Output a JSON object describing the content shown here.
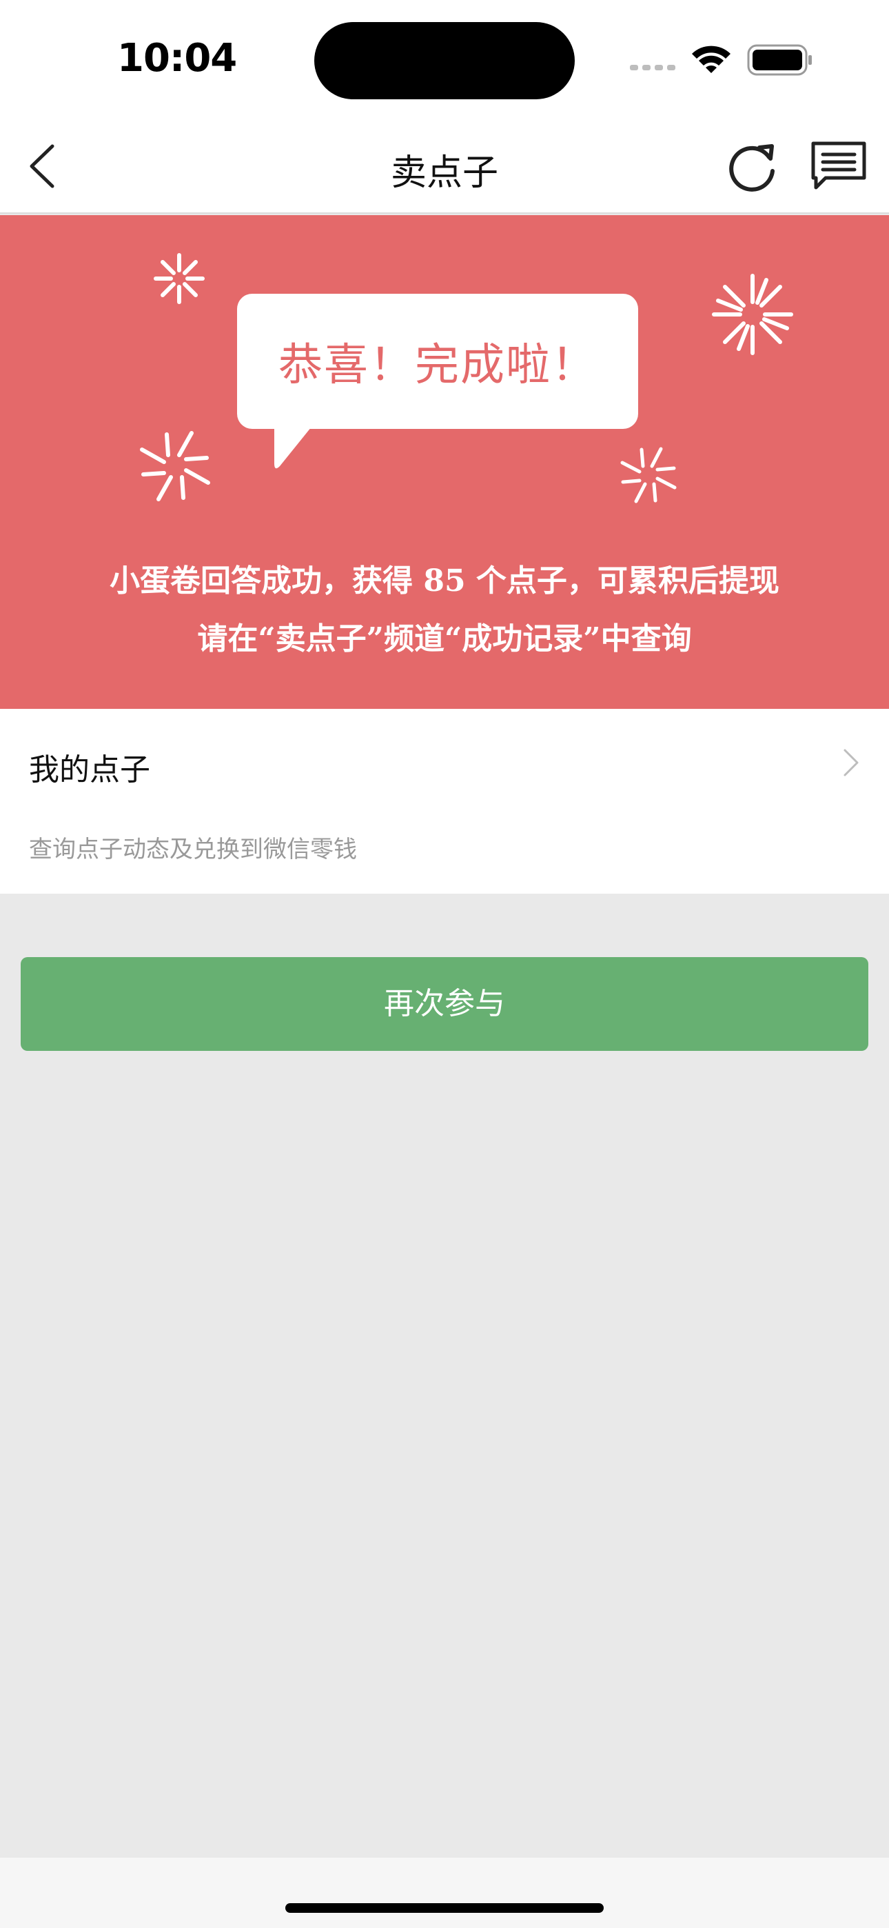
{
  "status_bar": {
    "time": "10:04"
  },
  "nav": {
    "title": "卖点子",
    "back_icon": "chevron-left-icon",
    "refresh_icon": "refresh-icon",
    "message_icon": "message-icon"
  },
  "banner": {
    "bubble_text": "恭喜！完成啦！",
    "line1": "小蛋卷回答成功，获得 85 个点子，可累积后提现",
    "line2": "请在“卖点子”频道“成功记录”中查询",
    "background_color": "#e4696a"
  },
  "my_ideas": {
    "title": "我的点子",
    "subtitle": "查询点子动态及兑换到微信零钱"
  },
  "actions": {
    "participate_again": "再次参与",
    "button_color": "#67b072"
  }
}
